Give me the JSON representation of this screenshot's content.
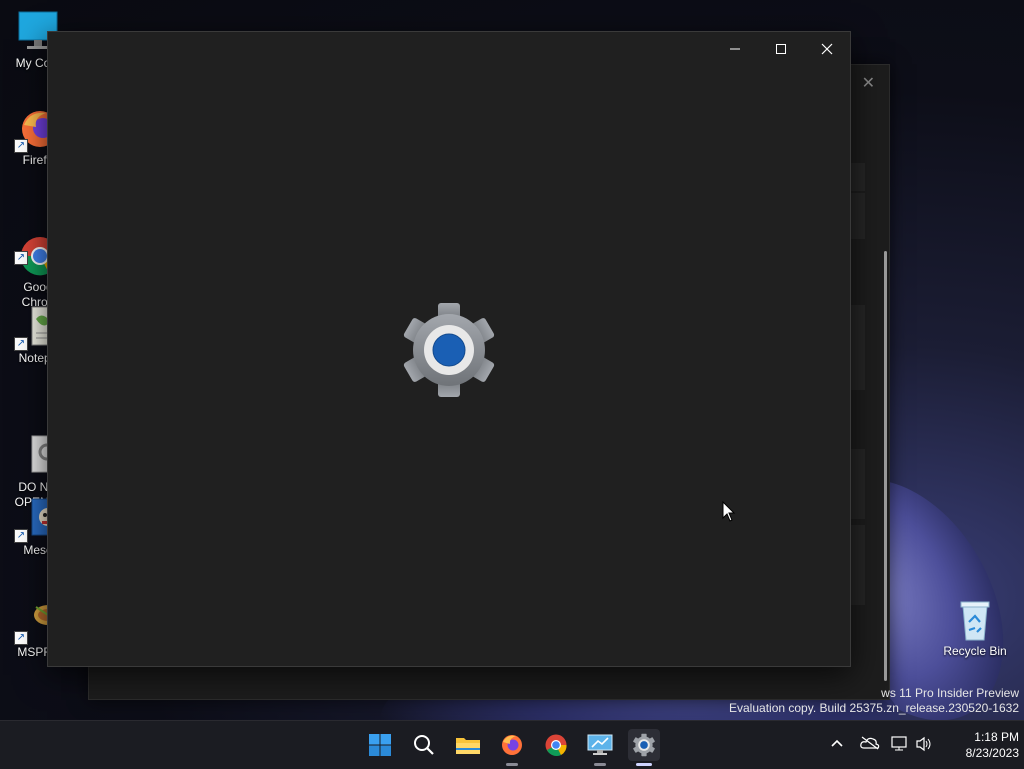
{
  "desktop": {
    "icons": [
      {
        "label": "My Com",
        "icon": "monitor-icon"
      },
      {
        "label": "Firefo",
        "icon": "firefox-icon"
      },
      {
        "label": "Goog\nChron",
        "icon": "chrome-icon"
      },
      {
        "label": "Notepa",
        "icon": "notepad-icon"
      },
      {
        "label": "DO NO\nOPEN O",
        "icon": "settings-file-icon"
      },
      {
        "label": "Mese",
        "icon": "mesen-icon"
      },
      {
        "label": "MSPRa",
        "icon": "msp-icon"
      }
    ],
    "recycle_bin": {
      "label": "Recycle Bin",
      "icon": "recycle-bin-icon"
    }
  },
  "background_window": {
    "close_icon": "close-icon"
  },
  "main_window": {
    "controls": {
      "minimize": "minimize-icon",
      "maximize": "maximize-icon",
      "close": "close-icon"
    },
    "splash_icon": "settings-gear-icon"
  },
  "watermark": {
    "line1": "ws 11 Pro Insider Preview",
    "line2": "Evaluation copy. Build 25375.zn_release.230520-1632"
  },
  "taskbar": {
    "apps": [
      {
        "name": "Start",
        "icon": "windows-start-icon"
      },
      {
        "name": "Search",
        "icon": "search-icon"
      },
      {
        "name": "File Explorer",
        "icon": "folder-icon"
      },
      {
        "name": "Firefox",
        "icon": "firefox-icon"
      },
      {
        "name": "Google Chrome",
        "icon": "chrome-icon"
      },
      {
        "name": "Remote Desktop",
        "icon": "remote-desktop-icon"
      },
      {
        "name": "Settings",
        "icon": "settings-gear-icon"
      }
    ],
    "tray": {
      "chevron": "chevron-up-icon",
      "network_off": "cloud-off-icon",
      "network": "network-icon",
      "volume": "volume-icon"
    },
    "clock": {
      "time": "1:18 PM",
      "date": "8/23/2023"
    }
  },
  "colors": {
    "window_bg": "#202020",
    "gear_gray": "#8e9297",
    "gear_blue": "#1a5fb4",
    "taskbar_bg": "#1b1c22"
  }
}
